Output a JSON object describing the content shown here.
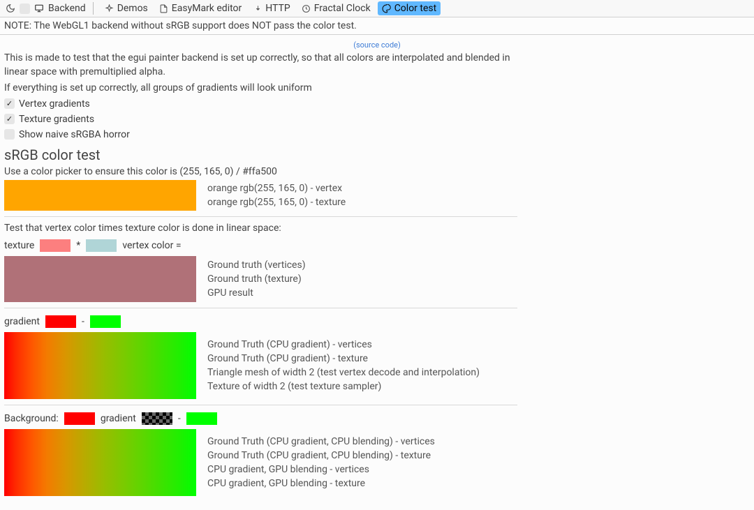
{
  "toolbar": {
    "backend_label": "Backend",
    "items": [
      {
        "label": "Demos"
      },
      {
        "label": "EasyMark editor"
      },
      {
        "label": "HTTP"
      },
      {
        "label": "Fractal Clock"
      },
      {
        "label": "Color test",
        "active": true
      }
    ]
  },
  "note": "NOTE: The WebGL1 backend without sRGB support does NOT pass the color test.",
  "source_link": "(source code)",
  "intro": {
    "p1": "This is made to test that the egui painter backend is set up correctly, so that all colors are interpolated and blended in linear space with premultiplied alpha.",
    "p2": "If everything is set up correctly, all groups of gradients will look uniform"
  },
  "checks": {
    "vertex": {
      "label": "Vertex gradients",
      "checked": true
    },
    "texture": {
      "label": "Texture gradients",
      "checked": true
    },
    "horror": {
      "label": "Show naive sRGBA horror",
      "checked": false
    }
  },
  "srgb": {
    "title": "sRGB color test",
    "instruction": "Use a color picker to ensure this color is (255, 165, 0) / #ffa500",
    "color": "#ffa500",
    "labels": {
      "vertex": "orange rgb(255, 165, 0) - vertex",
      "texture": "orange rgb(255, 165, 0) - texture"
    }
  },
  "linear_mul": {
    "heading": "Test that vertex color times texture color is done in linear space:",
    "texture_label": "texture",
    "star": "*",
    "vertex_label": "vertex color =",
    "texture_color": "#fc7f7f",
    "vertex_color": "#b0d5d7",
    "product_color": "#b07178",
    "labels": {
      "gtv": "Ground truth (vertices)",
      "gtt": "Ground truth (texture)",
      "gpu": "GPU result"
    }
  },
  "gradient": {
    "label": "gradient",
    "dash": "-",
    "left_color": "#ff0000",
    "right_color": "#00ff00",
    "labels": {
      "l1": "Ground Truth (CPU gradient) - vertices",
      "l2": "Ground Truth (CPU gradient) - texture",
      "l3": "Triangle mesh of width 2 (test vertex decode and interpolation)",
      "l4": "Texture of width 2 (test texture sampler)"
    }
  },
  "background": {
    "label": "Background:",
    "bg_color": "#ff0000",
    "grad_label": "gradient",
    "dash": "-",
    "right_color": "#00ff00",
    "labels": {
      "l1": "Ground Truth (CPU gradient, CPU blending) - vertices",
      "l2": "Ground Truth (CPU gradient, CPU blending) - texture",
      "l3": "CPU gradient, GPU blending - vertices",
      "l4": "CPU gradient, GPU blending - texture"
    }
  }
}
